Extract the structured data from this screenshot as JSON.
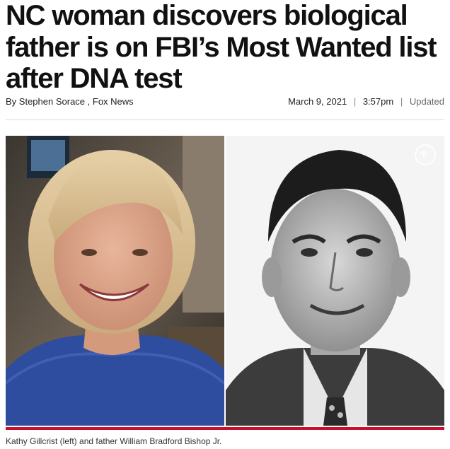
{
  "article": {
    "headline": "NC woman discovers biological father is on FBI’s Most Wanted list after DNA test",
    "byline_prefix": "By",
    "author": "Stephen Sorace",
    "source": "Fox News",
    "date": "March 9, 2021",
    "time": "3:57pm",
    "updated_label": "Updated",
    "separator": "|"
  },
  "photo": {
    "caption": "Kathy Gillcrist (left) and father William Bradford Bishop Jr.",
    "expand_icon": "plus-circle-icon"
  },
  "colors": {
    "accent_red": "#c8102e",
    "text": "#111111",
    "rule": "#d9d9d9"
  }
}
